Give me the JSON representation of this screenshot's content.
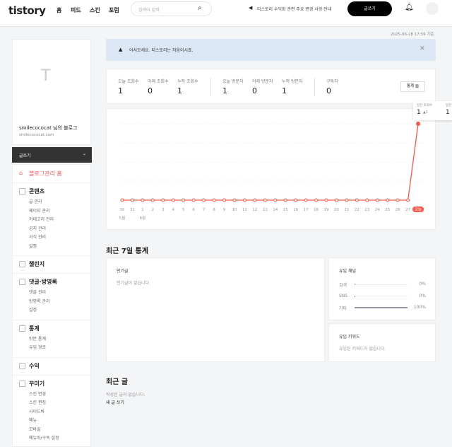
{
  "header": {
    "logo": "tistory",
    "nav": [
      "홈",
      "피드",
      "스킨",
      "포럼"
    ],
    "search_placeholder": "검색어 입력",
    "announcement": "티스토리 수익화 관련 주요 변경 사항 안내",
    "write_label": "글쓰기"
  },
  "timestamp": "2025-06-28 17:59 기준",
  "welcome": "어서오세요. 티스토리는 처음이시죠.",
  "sidebar": {
    "blog_name": "smilecococat 님의 블로그",
    "blog_url": "smilecococat.com",
    "write_label": "글쓰기",
    "home": "블로그관리 홈",
    "sections": [
      {
        "title": "콘텐츠",
        "items": [
          "글 관리",
          "페이지 관리",
          "카테고리 관리",
          "공지 관리",
          "서식 관리",
          "설정"
        ]
      },
      {
        "title": "챌린지",
        "items": []
      },
      {
        "title": "댓글·방명록",
        "items": [
          "댓글 관리",
          "방명록 관리",
          "설정"
        ]
      },
      {
        "title": "통계",
        "items": [
          "방문 통계",
          "유입 경로"
        ]
      },
      {
        "title": "수익",
        "items": []
      },
      {
        "title": "꾸미기",
        "items": [
          "스킨 변경",
          "스킨 편집",
          "사이드바",
          "메뉴",
          "모바일",
          "메뉴바/구독 설정"
        ]
      }
    ]
  },
  "stats": {
    "items": [
      {
        "label": "오늘 조회수",
        "value": "1"
      },
      {
        "label": "어제 조회수",
        "value": "0"
      },
      {
        "label": "누적 조회수",
        "value": "1"
      },
      {
        "label": "오늘 방문자",
        "value": "1"
      },
      {
        "label": "어제 방문자",
        "value": "0"
      },
      {
        "label": "누적 방문자",
        "value": "1"
      },
      {
        "label": "구독자",
        "value": "0"
      }
    ],
    "button": "통계"
  },
  "tooltip": {
    "label1": "일간 조회수",
    "value1": "1",
    "delta1": "1",
    "label2": "일간",
    "value2": "1"
  },
  "chart_data": {
    "type": "line",
    "x": [
      "30",
      "31",
      "1",
      "2",
      "3",
      "4",
      "5",
      "6",
      "7",
      "8",
      "9",
      "10",
      "11",
      "12",
      "13",
      "14",
      "15",
      "16",
      "17",
      "18",
      "19",
      "20",
      "21",
      "22",
      "23",
      "24",
      "25",
      "26",
      "27",
      "오늘"
    ],
    "month_labels": [
      "5월",
      "6월"
    ],
    "values": [
      0,
      0,
      0,
      0,
      0,
      0,
      0,
      0,
      0,
      0,
      0,
      0,
      0,
      0,
      0,
      0,
      0,
      0,
      0,
      0,
      0,
      0,
      0,
      0,
      0,
      0,
      0,
      0,
      0,
      1
    ],
    "color": "#ff5544",
    "grid": true
  },
  "recent7": {
    "title": "최근 7일 통계",
    "popular_title": "인기글",
    "popular_empty": "인기글이 없습니다.",
    "channel_title": "유입 채널",
    "channels": [
      {
        "name": "검색",
        "pct": "0%",
        "value": 0
      },
      {
        "name": "SNS",
        "pct": "0%",
        "value": 0
      },
      {
        "name": "기타",
        "pct": "100%",
        "value": 100
      }
    ],
    "keyword_title": "유입 키워드",
    "keyword_empty": "유입된 키워드가 없습니다."
  },
  "recent_posts": {
    "title": "최근 글",
    "empty": "작성된 글이 없습니다.",
    "new_post": "새 글 쓰기"
  }
}
